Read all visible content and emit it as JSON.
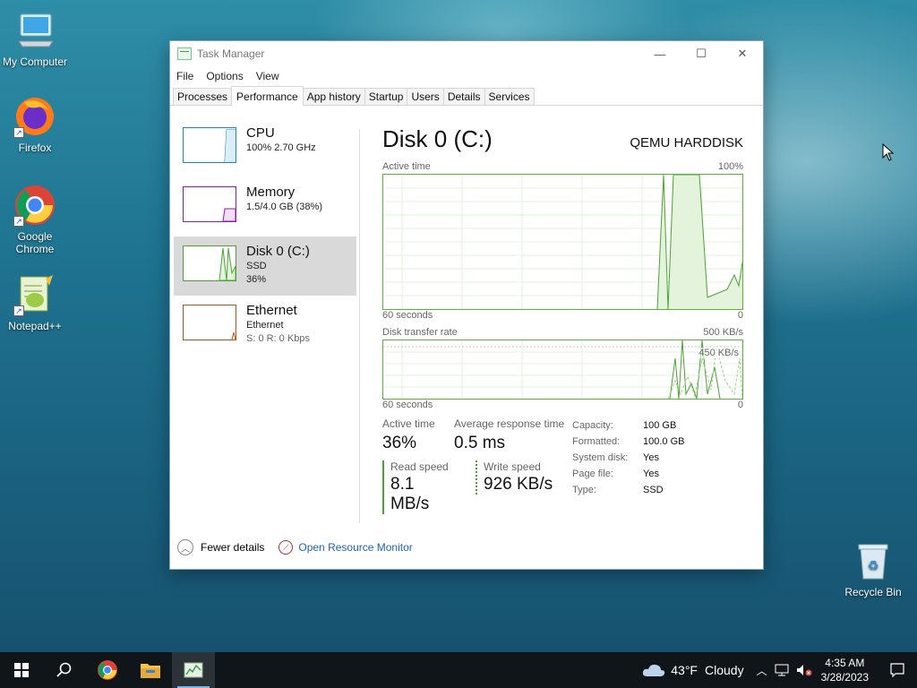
{
  "desktop": {
    "icons": [
      {
        "label": "My Computer"
      },
      {
        "label": "Firefox"
      },
      {
        "label": "Google Chrome"
      },
      {
        "label": "Notepad++"
      },
      {
        "label": "Recycle Bin"
      }
    ]
  },
  "window": {
    "title": "Task Manager",
    "controls": {
      "minimize": "—",
      "maximize": "☐",
      "close": "✕"
    },
    "menu": [
      "File",
      "Options",
      "View"
    ],
    "tabs": [
      "Processes",
      "Performance",
      "App history",
      "Startup",
      "Users",
      "Details",
      "Services"
    ],
    "active_tab": "Performance",
    "sidebar": [
      {
        "title": "CPU",
        "line1": "100%  2.70 GHz",
        "line2": "",
        "color": "#1f82c8"
      },
      {
        "title": "Memory",
        "line1": "1.5/4.0 GB (38%)",
        "line2": "",
        "color": "#8b1fa6"
      },
      {
        "title": "Disk 0 (C:)",
        "line1": "SSD",
        "line2": "36%",
        "color": "#4da234"
      },
      {
        "title": "Ethernet",
        "line1": "Ethernet",
        "line2": "S: 0 R: 0 Kbps",
        "color": "#a2581f"
      }
    ],
    "detail": {
      "title": "Disk 0 (C:)",
      "model": "QEMU HARDDISK",
      "graph1": {
        "label": "Active time",
        "max": "100%",
        "time": "60 seconds",
        "min": "0"
      },
      "graph2": {
        "label": "Disk transfer rate",
        "max": "500 KB/s",
        "inner_label": "450 KB/s",
        "time": "60 seconds",
        "min": "0"
      },
      "active_time_label": "Active time",
      "active_time_value": "36%",
      "avg_resp_label": "Average response time",
      "avg_resp_value": "0.5 ms",
      "read_label": "Read speed",
      "read_value": "8.1 MB/s",
      "write_label": "Write speed",
      "write_value": "926 KB/s",
      "props": [
        {
          "k": "Capacity:",
          "v": "100 GB"
        },
        {
          "k": "Formatted:",
          "v": "100.0 GB"
        },
        {
          "k": "System disk:",
          "v": "Yes"
        },
        {
          "k": "Page file:",
          "v": "Yes"
        },
        {
          "k": "Type:",
          "v": "SSD"
        }
      ]
    },
    "footer": {
      "fewer": "Fewer details",
      "monitor": "Open Resource Monitor"
    }
  },
  "taskbar": {
    "weather": {
      "temp": "43°F",
      "cond": "Cloudy"
    },
    "time": "4:35 AM",
    "date": "3/28/2023"
  }
}
